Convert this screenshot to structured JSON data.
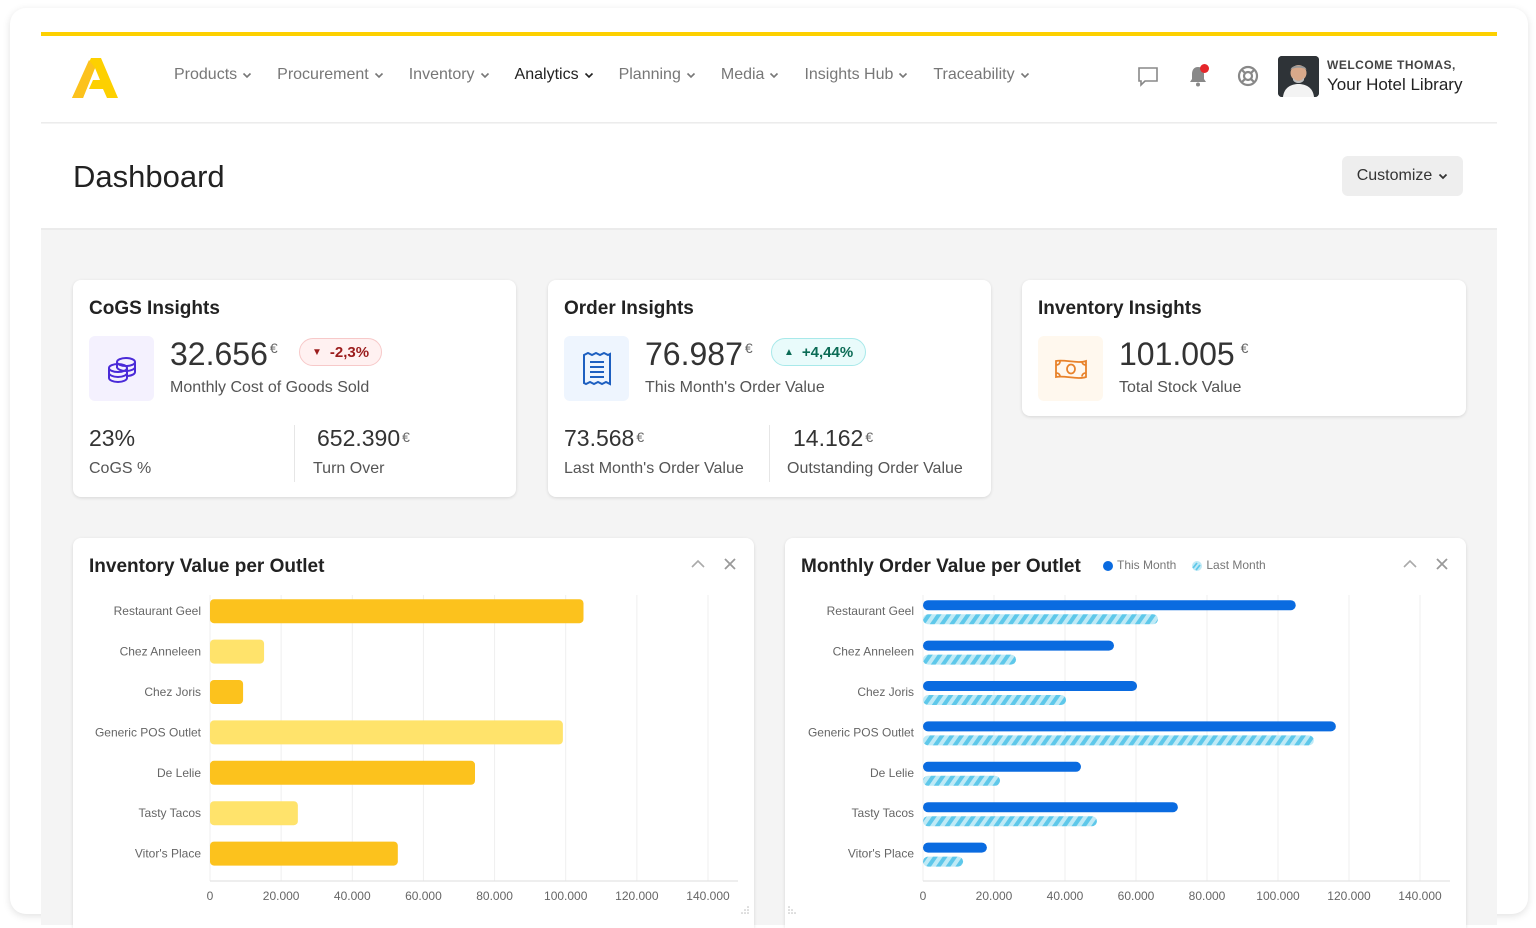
{
  "nav": {
    "items": [
      {
        "label": "Products",
        "active": false
      },
      {
        "label": "Procurement",
        "active": false
      },
      {
        "label": "Inventory",
        "active": false
      },
      {
        "label": "Analytics",
        "active": true
      },
      {
        "label": "Planning",
        "active": false
      },
      {
        "label": "Media",
        "active": false
      },
      {
        "label": "Insights Hub",
        "active": false
      },
      {
        "label": "Traceability",
        "active": false
      }
    ],
    "icons": [
      "chat-icon",
      "bell-icon",
      "help-lifebuoy-icon"
    ],
    "notification_dot": true
  },
  "user": {
    "welcome": "WELCOME THOMAS,",
    "org": "Your Hotel Library"
  },
  "page": {
    "title": "Dashboard",
    "customize_label": "Customize"
  },
  "colors": {
    "brand_yellow": "#fdd000",
    "bar_dark_yellow": "#fcc21d",
    "bar_light_yellow": "#ffe36b",
    "this_month_blue": "#0a6be0",
    "last_month_cyan": "#5ec8ea",
    "neg_badge": "#9b1c1c",
    "pos_badge": "#0b6b55"
  },
  "cogs": {
    "title": "CoGS Insights",
    "value": "32.656",
    "currency": "€",
    "label": "Monthly Cost of Goods Sold",
    "badge": "-2,3%",
    "badge_direction": "down",
    "pct_value": "23%",
    "pct_label": "CoGS %",
    "turnover_value": "652.390",
    "turnover_label": "Turn Over"
  },
  "orders": {
    "title": "Order Insights",
    "value": "76.987",
    "currency": "€",
    "label": "This Month's Order Value",
    "badge": "+4,44%",
    "badge_direction": "up",
    "last_value": "73.568",
    "last_label": "Last Month's Order Value",
    "outstanding_value": "14.162",
    "outstanding_label": "Outstanding Order Value"
  },
  "inventory": {
    "title": "Inventory Insights",
    "value": "101.005",
    "currency": "€",
    "label": "Total Stock Value"
  },
  "chart_data": [
    {
      "type": "bar",
      "orientation": "horizontal",
      "title": "Inventory Value per Outlet",
      "categories": [
        "Restaurant Geel",
        "Chez Anneleen",
        "Chez Joris",
        "Generic POS Outlet",
        "De Lelie",
        "Tasty Tacos",
        "Vitor's Place"
      ],
      "values": [
        105000,
        15200,
        9300,
        99200,
        74500,
        24700,
        52800
      ],
      "xlim": [
        0,
        140000
      ],
      "xticks": [
        "0",
        "20.000",
        "40.000",
        "60.000",
        "80.000",
        "100.000",
        "120.000",
        "140.000"
      ],
      "xtick_values": [
        0,
        20000,
        40000,
        60000,
        80000,
        100000,
        120000,
        140000
      ],
      "grid": true,
      "xlabel": "",
      "ylabel": ""
    },
    {
      "type": "bar",
      "orientation": "horizontal",
      "title": "Monthly Order Value per Outlet",
      "categories": [
        "Restaurant Geel",
        "Chez Anneleen",
        "Chez Joris",
        "Generic POS Outlet",
        "De Lelie",
        "Tasty Tacos",
        "Vitor's Place"
      ],
      "series": [
        {
          "name": "This Month",
          "values": [
            105000,
            53800,
            60300,
            116300,
            44500,
            71800,
            18000
          ]
        },
        {
          "name": "Last Month",
          "values": [
            66200,
            26200,
            40300,
            110100,
            21700,
            49000,
            11300
          ]
        }
      ],
      "legend": "top-left",
      "xlim": [
        0,
        140000
      ],
      "xticks": [
        "0",
        "20.000",
        "40.000",
        "60.000",
        "80.000",
        "100.000",
        "120.000",
        "140.000"
      ],
      "xtick_values": [
        0,
        20000,
        40000,
        60000,
        80000,
        100000,
        120000,
        140000
      ],
      "grid": true,
      "xlabel": "",
      "ylabel": ""
    }
  ]
}
